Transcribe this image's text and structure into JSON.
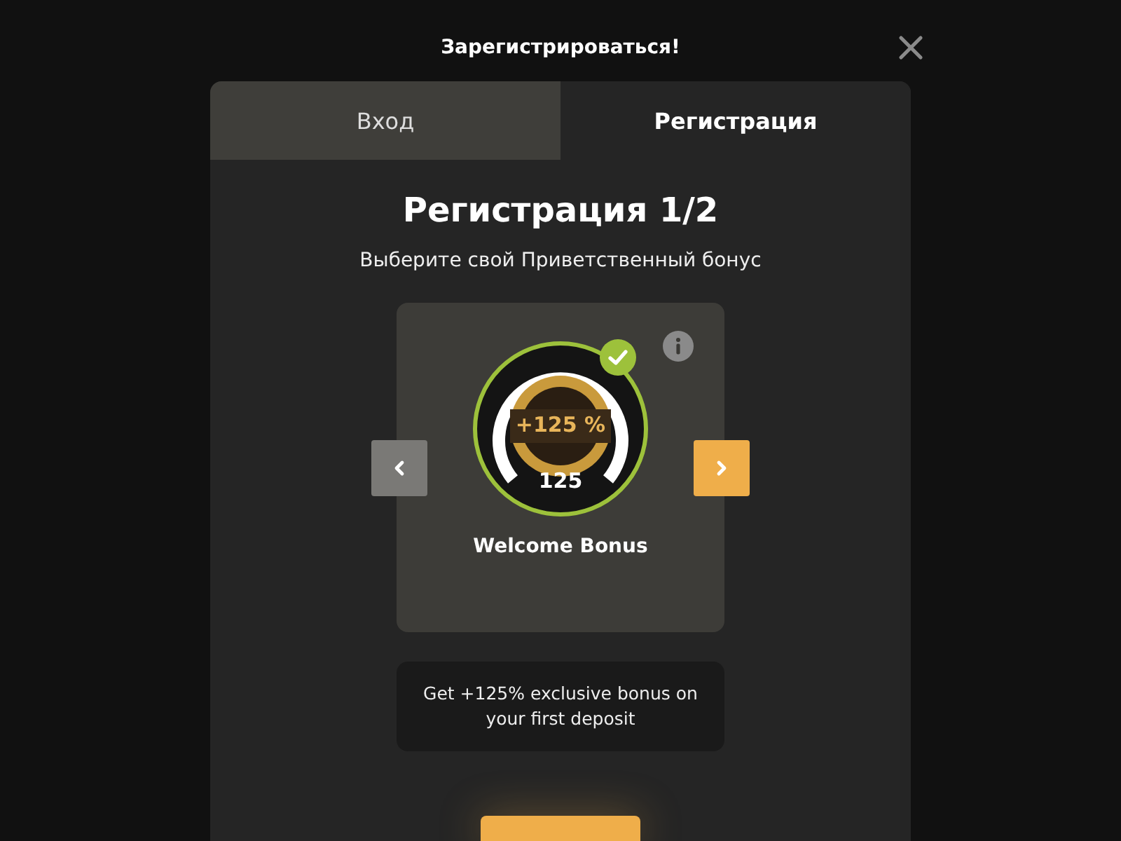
{
  "dialog": {
    "title": "Зарегистрироваться!"
  },
  "tabs": [
    {
      "label": "Вход",
      "selected": false
    },
    {
      "label": "Регистрация",
      "selected": true
    }
  ],
  "heading": "Регистрация 1/2",
  "subtitle": "Выберите свой Приветственный бонус",
  "bonus_card": {
    "badge": "+125 %",
    "value": "125",
    "name": "Welcome Bonus",
    "selected": true
  },
  "carousel": {
    "prev_disabled": true,
    "next_disabled": false
  },
  "description": "Get +125% exclusive bonus on your first deposit"
}
